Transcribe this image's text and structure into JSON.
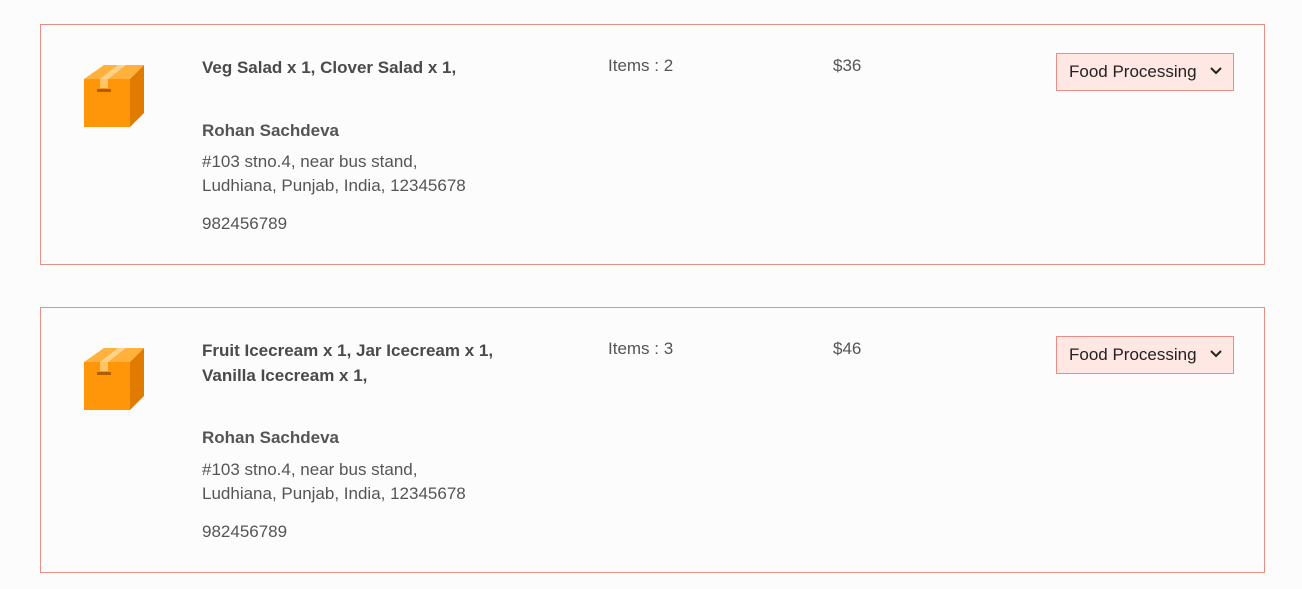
{
  "orders": [
    {
      "items_text": "Veg Salad x 1, Clover Salad x 1,",
      "customer_name": "Rohan Sachdeva",
      "address_line1": "#103 stno.4, near bus stand,",
      "address_line2": "Ludhiana, Punjab, India, 12345678",
      "phone": "982456789",
      "items_count": "Items : 2",
      "amount": "$36",
      "status": "Food Processing"
    },
    {
      "items_text": "Fruit Icecream x 1, Jar Icecream x 1, Vanilla Icecream x 1,",
      "customer_name": "Rohan Sachdeva",
      "address_line1": "#103 stno.4, near bus stand,",
      "address_line2": "Ludhiana, Punjab, India, 12345678",
      "phone": "982456789",
      "items_count": "Items : 3",
      "amount": "$46",
      "status": "Food Processing"
    }
  ],
  "icons": {
    "order": "parcel-box-icon",
    "select": "chevron-down-icon"
  },
  "colors": {
    "card_border": "#e88e84",
    "select_background": "#ffe7e3",
    "box_orange": "#ff9a0a",
    "text": "#4a4a4a"
  }
}
